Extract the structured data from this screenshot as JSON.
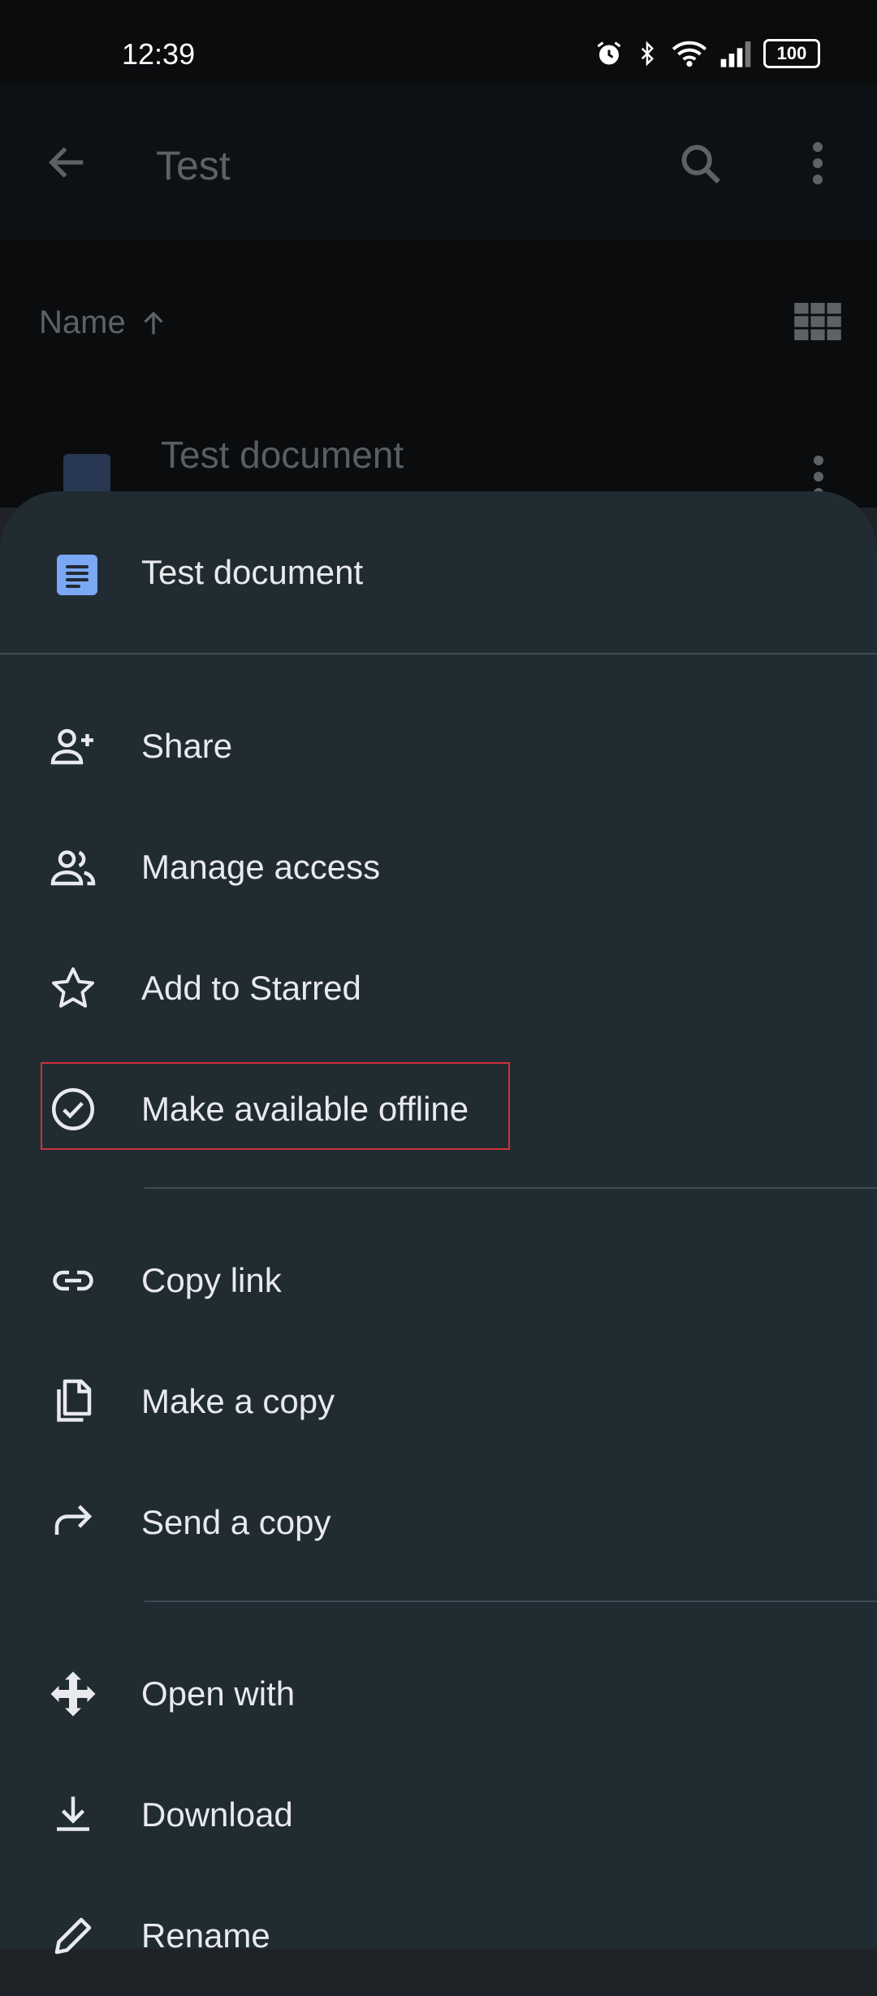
{
  "status_bar": {
    "time": "12:39",
    "battery": "100"
  },
  "app_bar": {
    "title": "Test"
  },
  "list": {
    "sort_label": "Name",
    "items": [
      {
        "title": "Test document"
      }
    ]
  },
  "sheet": {
    "title": "Test document",
    "menu": [
      {
        "label": "Share",
        "icon": "person-add-icon"
      },
      {
        "label": "Manage access",
        "icon": "people-icon"
      },
      {
        "label": "Add to Starred",
        "icon": "star-icon"
      },
      {
        "label": "Make available offline",
        "icon": "offline-check-icon",
        "highlighted": true
      },
      {
        "label": "Copy link",
        "icon": "link-icon"
      },
      {
        "label": "Make a copy",
        "icon": "copy-icon"
      },
      {
        "label": "Send a copy",
        "icon": "forward-icon"
      },
      {
        "label": "Open with",
        "icon": "open-with-icon"
      },
      {
        "label": "Download",
        "icon": "download-icon"
      },
      {
        "label": "Rename",
        "icon": "edit-icon"
      }
    ]
  },
  "colors": {
    "sheet_bg": "#212b32",
    "doc_icon": "#7ba8f5",
    "highlight_border": "#d1323a"
  }
}
